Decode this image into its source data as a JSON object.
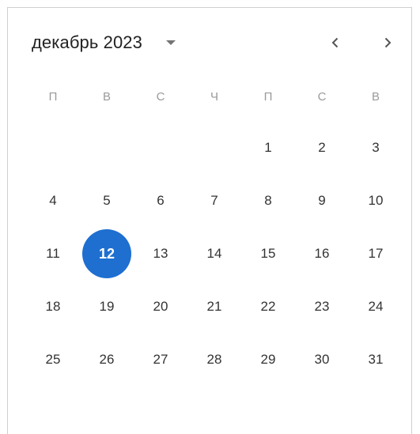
{
  "calendar": {
    "month_label": "декабрь 2023",
    "weekdays": [
      "П",
      "В",
      "С",
      "Ч",
      "П",
      "С",
      "В"
    ],
    "weeks": [
      [
        "",
        "",
        "",
        "",
        "1",
        "2",
        "3"
      ],
      [
        "4",
        "5",
        "6",
        "7",
        "8",
        "9",
        "10"
      ],
      [
        "11",
        "12",
        "13",
        "14",
        "15",
        "16",
        "17"
      ],
      [
        "18",
        "19",
        "20",
        "21",
        "22",
        "23",
        "24"
      ],
      [
        "25",
        "26",
        "27",
        "28",
        "29",
        "30",
        "31"
      ]
    ],
    "selected_day": "12",
    "accent_color": "#1e6fd0",
    "icons": {
      "month_dropdown": "caret-down-icon",
      "prev": "chevron-left-icon",
      "next": "chevron-right-icon"
    }
  }
}
